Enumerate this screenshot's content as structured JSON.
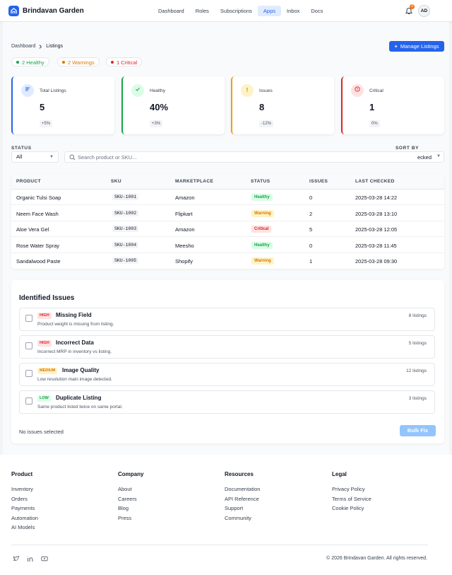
{
  "header": {
    "brand": "Brindavan Garden",
    "nav": [
      "Dashboard",
      "Roles",
      "Subscriptions",
      "Apps",
      "Inbox",
      "Docs"
    ],
    "active_nav": "Apps",
    "notif_count": "3",
    "avatar_initials": "AD"
  },
  "breadcrumb": {
    "root": "Dashboard",
    "current": "Listings"
  },
  "manage_button": "Manage Listings",
  "status_pills": [
    {
      "label": "2 Healthy",
      "color": "#16a34a"
    },
    {
      "label": "2 Warnings",
      "color": "#d97706"
    },
    {
      "label": "1 Critical",
      "color": "#dc2626"
    }
  ],
  "stats": [
    {
      "label": "Total Listings",
      "value": "5",
      "delta": "+5%",
      "accent": "#2563eb"
    },
    {
      "label": "Healthy",
      "value": "40%",
      "delta": "+3%",
      "accent": "#16a34a"
    },
    {
      "label": "Issues",
      "value": "8",
      "delta": "-12%",
      "accent": "#f59e0b"
    },
    {
      "label": "Critical",
      "value": "1",
      "delta": "0%",
      "accent": "#dc2626"
    }
  ],
  "filters": {
    "status_label": "STATUS",
    "status_value": "All",
    "search_placeholder": "Search product or SKU...",
    "sort_label": "SORT BY",
    "sort_value": "ecked"
  },
  "table": {
    "columns": [
      "PRODUCT",
      "SKU",
      "MARKETPLACE",
      "STATUS",
      "ISSUES",
      "LAST CHECKED"
    ],
    "rows": [
      {
        "product": "Organic Tulsi Soap",
        "sku": "SKU-1001",
        "marketplace": "Amazon",
        "status": "Healthy",
        "issues": "0",
        "checked": "2025-03-28 14:22"
      },
      {
        "product": "Neem Face Wash",
        "sku": "SKU-1002",
        "marketplace": "Flipkart",
        "status": "Warning",
        "issues": "2",
        "checked": "2025-03-28 13:10"
      },
      {
        "product": "Aloe Vera Gel",
        "sku": "SKU-1003",
        "marketplace": "Amazon",
        "status": "Critical",
        "issues": "5",
        "checked": "2025-03-28 12:05"
      },
      {
        "product": "Rose Water Spray",
        "sku": "SKU-1004",
        "marketplace": "Meesho",
        "status": "Healthy",
        "issues": "0",
        "checked": "2025-03-28 11:45"
      },
      {
        "product": "Sandalwood Paste",
        "sku": "SKU-1005",
        "marketplace": "Shopify",
        "status": "Warning",
        "issues": "1",
        "checked": "2025-03-28 09:30"
      }
    ]
  },
  "issues_section": {
    "title": "Identified Issues",
    "items": [
      {
        "severity": "HIGH",
        "title": "Missing Field",
        "desc": "Product weight is missing from listing.",
        "count": "8 listings"
      },
      {
        "severity": "HIGH",
        "title": "Incorrect Data",
        "desc": "Incorrect MRP in inventory vs listing.",
        "count": "5 listings"
      },
      {
        "severity": "MEDIUM",
        "title": "Image Quality",
        "desc": "Low resolution main image detected.",
        "count": "12 listings"
      },
      {
        "severity": "LOW",
        "title": "Duplicate Listing",
        "desc": "Same product listed twice on same portal.",
        "count": "3 listings"
      }
    ],
    "selection_text": "No issues selected",
    "bulk_button": "Bulk Fix"
  },
  "footer": {
    "columns": [
      {
        "title": "Product",
        "links": [
          "Inventory",
          "Orders",
          "Payments",
          "Automation",
          "AI Models"
        ]
      },
      {
        "title": "Company",
        "links": [
          "About",
          "Careers",
          "Blog",
          "Press"
        ]
      },
      {
        "title": "Resources",
        "links": [
          "Documentation",
          "API Reference",
          "Support",
          "Community"
        ]
      },
      {
        "title": "Legal",
        "links": [
          "Privacy Policy",
          "Terms of Service",
          "Cookie Policy"
        ]
      }
    ],
    "social_icons": [
      "twitter-icon",
      "linkedin-icon",
      "youtube-icon"
    ],
    "copyright": "© 2026 Brindavan Garden. All rights reserved."
  }
}
